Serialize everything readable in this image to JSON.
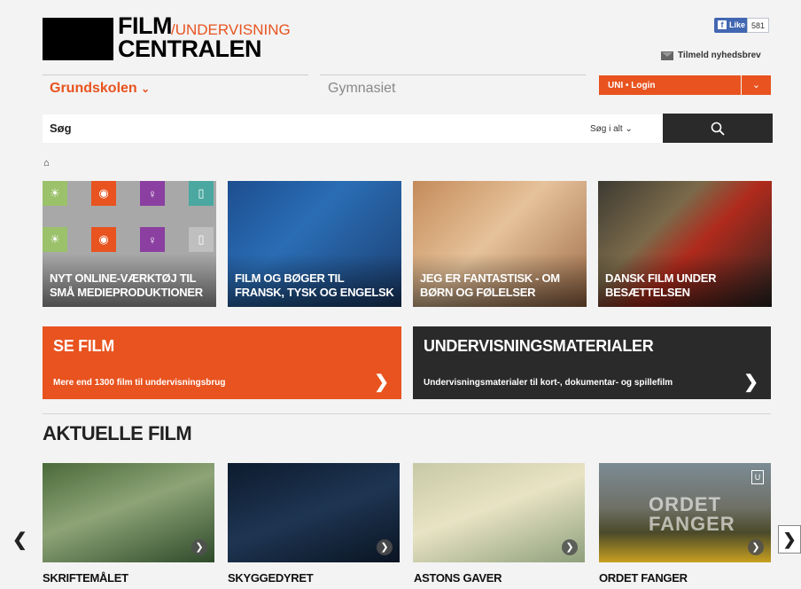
{
  "logo": {
    "line1": "FILM",
    "slash_text": "/UNDERVISNING",
    "line2": "CENTRALEN"
  },
  "facebook": {
    "like_label": "Like",
    "count": "581"
  },
  "newsletter": {
    "label": "Tilmeld nyhedsbrev",
    "icon": "mail-icon"
  },
  "nav": {
    "tab_grundskolen": "Grundskolen",
    "tab_gymnasiet": "Gymnasiet",
    "login_label": "UNI • Login"
  },
  "search": {
    "placeholder": "Søg",
    "scope_label": "Søg i alt",
    "button_icon": "search-icon"
  },
  "features": [
    {
      "title": "NYT ONLINE-VÆRKTØJ TIL SMÅ MEDIEPRODUKTIONER"
    },
    {
      "title": "FILM OG BØGER TIL FRANSK, TYSK OG ENGELSK"
    },
    {
      "title": "JEG ER FANTASTISK - OM BØRN OG FØLELSER"
    },
    {
      "title": "DANSK FILM UNDER BESÆTTELSEN"
    }
  ],
  "banners": {
    "se_film": {
      "title": "SE FILM",
      "subtitle": "Mere end 1300 film til undervisningsbrug"
    },
    "undervisning": {
      "title": "UNDERVISNINGSMATERIALER",
      "subtitle": "Undervisningsmaterialer til kort-, dokumentar- og spillefilm"
    }
  },
  "section_title": "AKTUELLE FILM",
  "films": [
    {
      "title": "SKRIFTEMÅLET"
    },
    {
      "title": "SKYGGEDYRET"
    },
    {
      "title": "ASTONS GAVER"
    },
    {
      "title": "ORDET FANGER",
      "poster_text": "ORDET FANGER",
      "badge": "U"
    }
  ],
  "colors": {
    "accent": "#e8531f",
    "dark": "#2a2a2a",
    "background": "#f3f3f3"
  }
}
